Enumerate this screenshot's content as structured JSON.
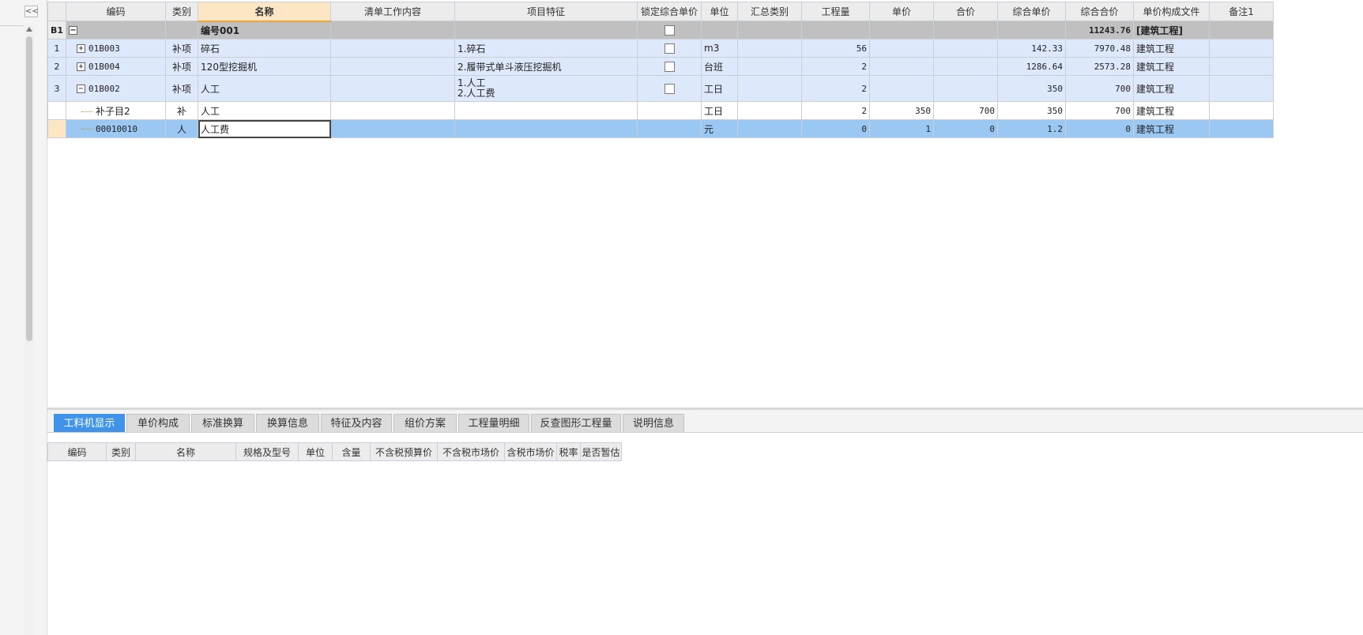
{
  "left_panel": {
    "collapse_label": "<<"
  },
  "main_grid": {
    "headers": [
      "",
      "编码",
      "类别",
      "名称",
      "清单工作内容",
      "项目特征",
      "锁定综合单价",
      "单位",
      "汇总类别",
      "工程量",
      "单价",
      "合价",
      "综合单价",
      "综合合价",
      "单价构成文件",
      "备注1"
    ],
    "group_row": {
      "row": "B1",
      "code": "",
      "type": "",
      "name": "编号001",
      "total": "11243.76",
      "file": "[建筑工程]"
    },
    "item_rows": [
      {
        "row": "1",
        "code": "01B003",
        "type": "补项",
        "name": "碎石",
        "feature": [
          "1.碎石"
        ],
        "unit": "m3",
        "qty": "56",
        "price": "",
        "sum": "",
        "unit_price": "142.33",
        "total": "7970.48",
        "file": "建筑工程"
      },
      {
        "row": "2",
        "code": "01B004",
        "type": "补项",
        "name": "120型挖掘机",
        "feature": [
          "2.履带式单斗液压挖掘机"
        ],
        "unit": "台班",
        "qty": "2",
        "price": "",
        "sum": "",
        "unit_price": "1286.64",
        "total": "2573.28",
        "file": "建筑工程"
      },
      {
        "row": "3",
        "code": "01B002",
        "type": "补项",
        "name": "人工",
        "feature": [
          "1.人工",
          "2.人工费"
        ],
        "unit": "工日",
        "qty": "2",
        "price": "",
        "sum": "",
        "unit_price": "350",
        "total": "700",
        "file": "建筑工程"
      }
    ],
    "sub_rows": [
      {
        "code": "补子目2",
        "type": "补",
        "name": "人工",
        "unit": "工日",
        "qty": "2",
        "price": "350",
        "sum": "700",
        "unit_price": "350",
        "total": "700",
        "file": "建筑工程"
      },
      {
        "code": "00010010",
        "type": "人",
        "name": "人工费",
        "unit": "元",
        "qty": "0",
        "price": "1",
        "sum": "0",
        "unit_price": "1.2",
        "total": "0",
        "file": "建筑工程"
      }
    ],
    "expand_symbol": "+",
    "collapse_symbol": "−"
  },
  "bottom_tabs": [
    "工料机显示",
    "单价构成",
    "标准换算",
    "换算信息",
    "特征及内容",
    "组价方案",
    "工程量明细",
    "反查图形工程量",
    "说明信息"
  ],
  "active_tab": 0,
  "sub_grid": {
    "headers": [
      "编码",
      "类别",
      "名称",
      "规格及型号",
      "单位",
      "含量",
      "不含税预算价",
      "不含税市场价",
      "含税市场价",
      "税率",
      "是否暂估"
    ]
  },
  "colors": {
    "active_tab": "#3f94e9",
    "selected_row": "#9bc8f3",
    "item_row": "#dde9fb",
    "group_row": "#c0c0c0"
  }
}
